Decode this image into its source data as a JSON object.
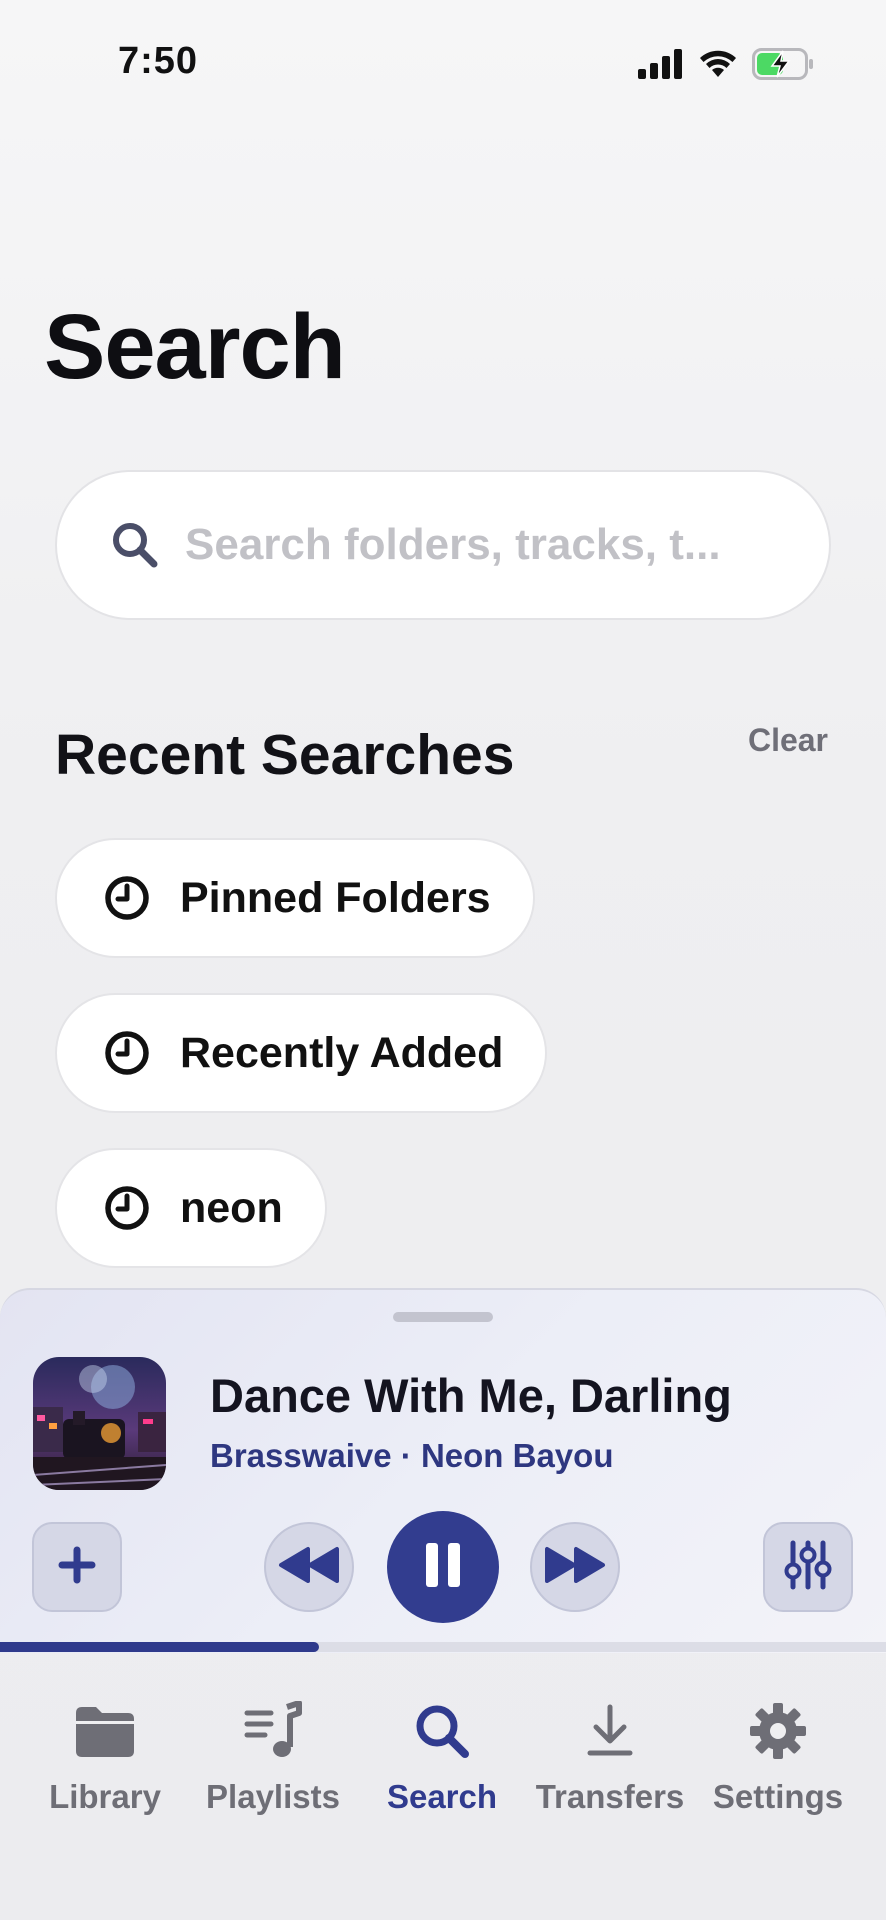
{
  "status": {
    "time": "7:50"
  },
  "page": {
    "title": "Search"
  },
  "search": {
    "placeholder": "Search folders, tracks, t..."
  },
  "recent": {
    "title": "Recent Searches",
    "clear_label": "Clear",
    "items": [
      {
        "label": "Pinned Folders"
      },
      {
        "label": "Recently Added"
      },
      {
        "label": "neon"
      }
    ]
  },
  "now_playing": {
    "title": "Dance With Me, Darling",
    "subtitle": "Brasswaive · Neon Bayou",
    "progress": 0.36,
    "is_playing": true
  },
  "tabs": [
    {
      "label": "Library",
      "icon": "folder-icon",
      "active": false
    },
    {
      "label": "Playlists",
      "icon": "playlist-icon",
      "active": false
    },
    {
      "label": "Search",
      "icon": "search-icon",
      "active": true
    },
    {
      "label": "Transfers",
      "icon": "download-icon",
      "active": false
    },
    {
      "label": "Settings",
      "icon": "gear-icon",
      "active": false
    }
  ],
  "colors": {
    "accent": "#303b8e",
    "inactive": "#6e6e76",
    "background": "#efeff1"
  }
}
